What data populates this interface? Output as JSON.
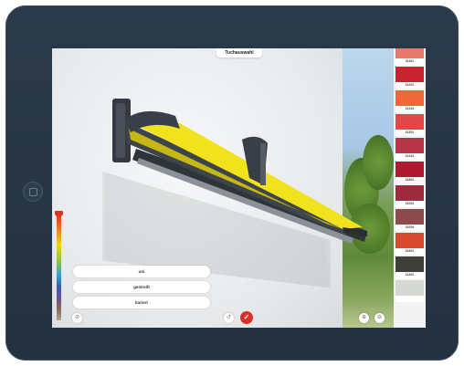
{
  "header": {
    "title": "Tuchauswahl"
  },
  "filters": [
    {
      "label": "uni"
    },
    {
      "label": "gestreift"
    },
    {
      "label": "kariert"
    }
  ],
  "buttons": {
    "left_small": "⊘",
    "center_small": "↺",
    "confirm": "✓",
    "zoom_in": "⊕",
    "zoom_out": "⊖"
  },
  "swatches": [
    {
      "code": "31811",
      "color": "#e57a6a"
    },
    {
      "code": "31201",
      "color": "#c8222f"
    },
    {
      "code": "31313",
      "color": "#f2663a"
    },
    {
      "code": "31301",
      "color": "#e04848"
    },
    {
      "code": "31313",
      "color": "#b83448"
    },
    {
      "code": "31801",
      "color": "#b01830"
    },
    {
      "code": "31001",
      "color": "#9e2a40"
    },
    {
      "code": "31004",
      "color": "#8e4a4c"
    },
    {
      "code": "31801",
      "color": "#d84a30"
    },
    {
      "code": "31301",
      "color": "#3e3e3a"
    },
    {
      "code": "",
      "color": "#d6d8d4"
    }
  ],
  "colors": {
    "accent": "#d8312a",
    "awning_fabric": "#f0e21c",
    "frame": "#3a3f47"
  }
}
